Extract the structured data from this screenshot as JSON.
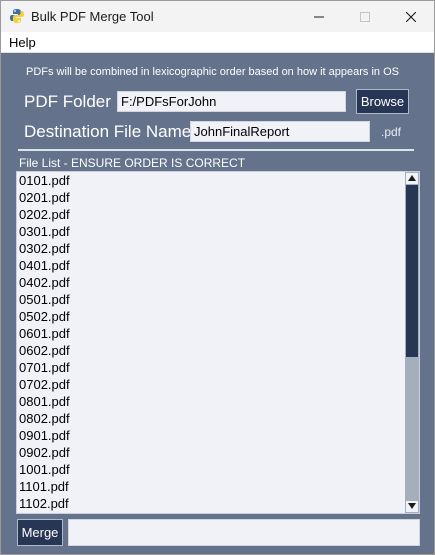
{
  "window": {
    "title": "Bulk PDF Merge Tool"
  },
  "menu": {
    "help": "Help"
  },
  "form": {
    "info": "PDFs will be combined in lexicographic order based on how it appears in OS",
    "folder_label": "PDF Folder",
    "folder_value": "F:/PDFsForJohn",
    "browse_label": "Browse",
    "dest_label": "Destination File Name",
    "dest_value": "JohnFinalReport",
    "ext": ".pdf"
  },
  "file_list": {
    "label": "File List - ENSURE ORDER IS CORRECT",
    "files": [
      "0101.pdf",
      "0201.pdf",
      "0202.pdf",
      "0301.pdf",
      "0302.pdf",
      "0401.pdf",
      "0402.pdf",
      "0501.pdf",
      "0502.pdf",
      "0601.pdf",
      "0602.pdf",
      "0701.pdf",
      "0702.pdf",
      "0801.pdf",
      "0802.pdf",
      "0901.pdf",
      "0902.pdf",
      "1001.pdf",
      "1101.pdf",
      "1102.pdf"
    ]
  },
  "footer": {
    "merge_label": "Merge",
    "status_text": ""
  },
  "colors": {
    "background": "#64738b",
    "button": "#283655",
    "field": "#f0f2f7"
  }
}
